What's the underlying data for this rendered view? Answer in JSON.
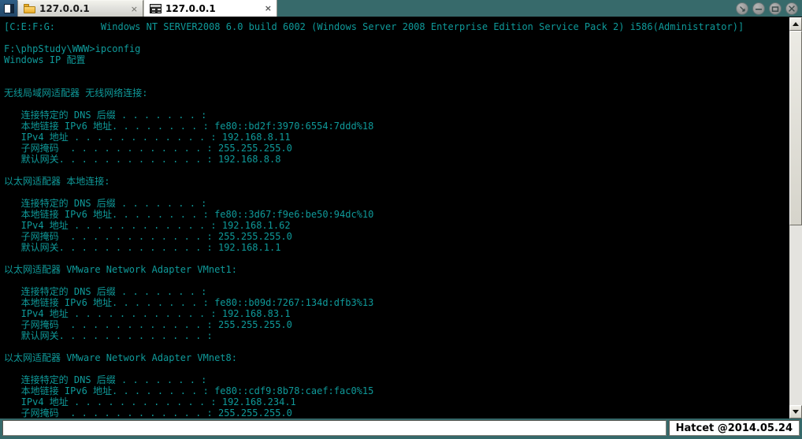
{
  "window": {
    "sysmenu_icon": "window-restore-icon",
    "controls": [
      {
        "name": "restore-down-button",
        "glyph": "↘"
      },
      {
        "name": "minimize-button",
        "glyph": "–"
      },
      {
        "name": "maximize-button",
        "glyph": "▭"
      },
      {
        "name": "close-button",
        "glyph": "✕"
      }
    ]
  },
  "tabs": [
    {
      "label": "127.0.0.1",
      "icon": "folder-icon",
      "close": "×",
      "active": false
    },
    {
      "label": "127.0.0.1",
      "icon": "console-icon",
      "close": "×",
      "active": true
    }
  ],
  "console": {
    "lines": [
      "[C:E:F:G:        Windows NT SERVER2008 6.0 build 6002 (Windows Server 2008 Enterprise Edition Service Pack 2) i586(Administrator)]",
      "",
      "F:\\phpStudy\\WWW>ipconfig",
      "Windows IP 配置",
      "",
      "",
      "无线局域网适配器 无线网络连接:",
      "",
      "   连接特定的 DNS 后缀 . . . . . . . :",
      "   本地链接 IPv6 地址. . . . . . . . : fe80::bd2f:3970:6554:7ddd%18",
      "   IPv4 地址 . . . . . . . . . . . . : 192.168.8.11",
      "   子网掩码  . . . . . . . . . . . . : 255.255.255.0",
      "   默认网关. . . . . . . . . . . . . : 192.168.8.8",
      "",
      "以太网适配器 本地连接:",
      "",
      "   连接特定的 DNS 后缀 . . . . . . . :",
      "   本地链接 IPv6 地址. . . . . . . . : fe80::3d67:f9e6:be50:94dc%10",
      "   IPv4 地址 . . . . . . . . . . . . : 192.168.1.62",
      "   子网掩码  . . . . . . . . . . . . : 255.255.255.0",
      "   默认网关. . . . . . . . . . . . . : 192.168.1.1",
      "",
      "以太网适配器 VMware Network Adapter VMnet1:",
      "",
      "   连接特定的 DNS 后缀 . . . . . . . :",
      "   本地链接 IPv6 地址. . . . . . . . : fe80::b09d:7267:134d:dfb3%13",
      "   IPv4 地址 . . . . . . . . . . . . : 192.168.83.1",
      "   子网掩码  . . . . . . . . . . . . : 255.255.255.0",
      "   默认网关. . . . . . . . . . . . . :",
      "",
      "以太网适配器 VMware Network Adapter VMnet8:",
      "",
      "   连接特定的 DNS 后缀 . . . . . . . :",
      "   本地链接 IPv6 地址. . . . . . . . : fe80::cdf9:8b78:caef:fac0%15",
      "   IPv4 地址 . . . . . . . . . . . . : 192.168.234.1",
      "   子网掩码  . . . . . . . . . . . . : 255.255.255.0"
    ],
    "text_color": "#0f9a9a",
    "background_color": "#000000"
  },
  "scrollbar": {
    "up_arrow": "scroll-up-arrow",
    "down_arrow": "scroll-down-arrow",
    "thumb_top_pct": 0,
    "thumb_height_pct": 52
  },
  "statusbar": {
    "left_text": "",
    "right_text": "Hatcet @2014.05.24"
  }
}
